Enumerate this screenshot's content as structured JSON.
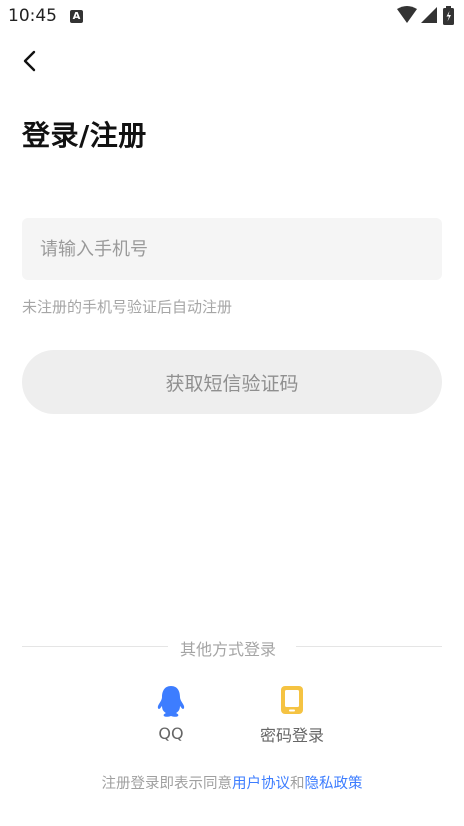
{
  "status_bar": {
    "time": "10:45",
    "notification_icon": "a-notification-icon",
    "wifi_icon": "wifi-icon",
    "signal_icon": "signal-icon",
    "battery_icon": "battery-icon"
  },
  "header": {
    "back_icon": "chevron-left-icon",
    "title": "登录/注册"
  },
  "form": {
    "phone_placeholder": "请输入手机号",
    "phone_value": "",
    "hint": "未注册的手机号验证后自动注册",
    "get_code_label": "获取短信验证码"
  },
  "other_login": {
    "divider_text": "其他方式登录",
    "options": [
      {
        "label": "QQ",
        "icon": "qq-icon",
        "color": "#3d7dff"
      },
      {
        "label": "密码登录",
        "icon": "phone-icon",
        "color": "#f5c342"
      }
    ]
  },
  "agreement": {
    "prefix": "注册登录即表示同意",
    "user_agreement": "用户协议",
    "and": "和",
    "privacy_policy": "隐私政策"
  },
  "colors": {
    "accent": "#3d7dff",
    "button_bg": "#eeeeee",
    "input_bg": "#f5f5f5"
  }
}
